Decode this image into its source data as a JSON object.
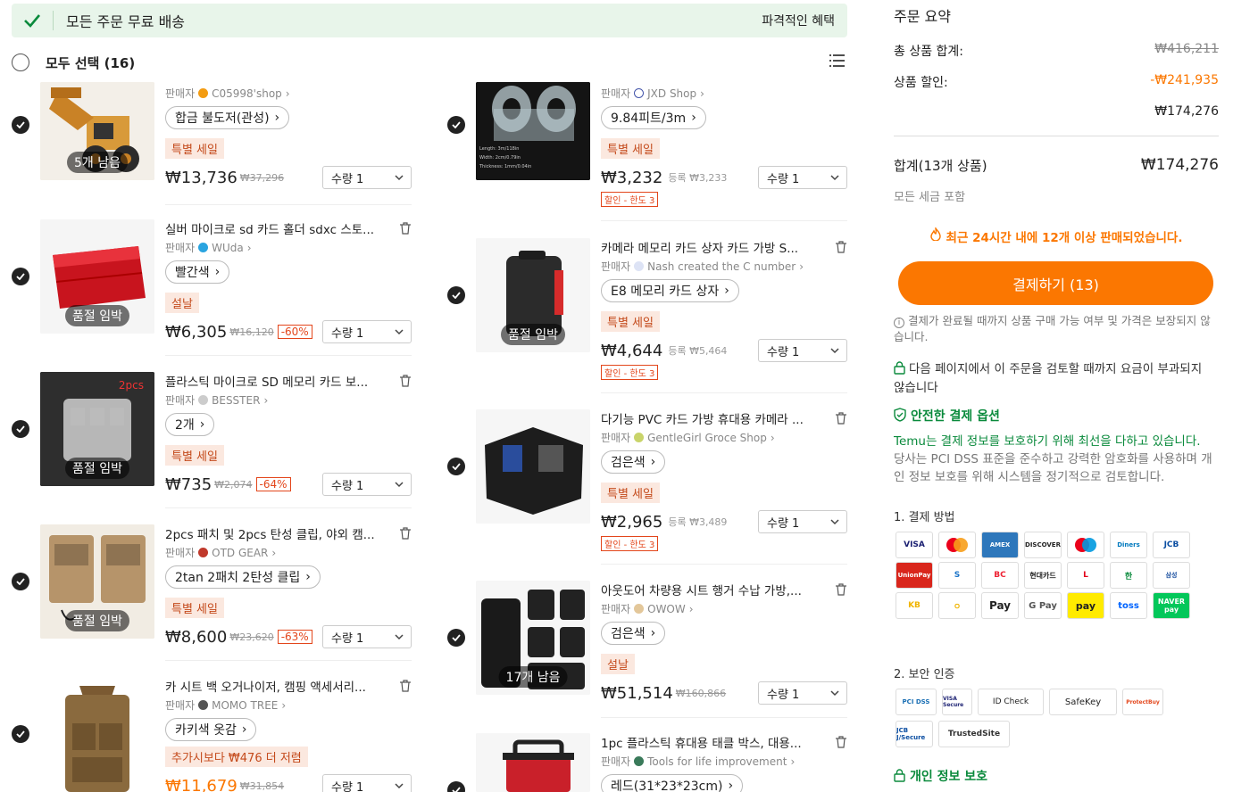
{
  "banner": {
    "title": "모든 주문 무료 배송",
    "right": "파격적인 혜택"
  },
  "select_all": {
    "label": "모두 선택 (16)"
  },
  "items_left": [
    {
      "seller": "C05998'shop",
      "variant": "합금 불도저(관성)",
      "tag": "특별 세일",
      "price": "₩13,736",
      "orig": "₩37,296",
      "qty": "수량 1",
      "badge": "5개 남음"
    },
    {
      "title": "실버 마이크로 sd 카드 홀더 sdxc 스토...",
      "seller": "WUda",
      "variant": "빨간색",
      "tag": "설날",
      "price": "₩6,305",
      "orig": "₩16,120",
      "disc": "-60%",
      "qty": "수량 1",
      "badge": "품절 임박"
    },
    {
      "title": "플라스틱 마이크로 SD 메모리 카드 보...",
      "seller": "BESSTER",
      "variant": "2개",
      "tag": "특별 세일",
      "price": "₩735",
      "orig": "₩2,074",
      "disc": "-64%",
      "qty": "수량 1",
      "badge": "품절 임박",
      "thumb_label": "2pcs"
    },
    {
      "title": "2pcs 패치 및 2pcs 탄성 클립, 야외 캠...",
      "seller": "OTD GEAR",
      "variant": "2tan 2패치 2탄성 클립",
      "tag": "특별 세일",
      "price": "₩8,600",
      "orig": "₩23,620",
      "disc": "-63%",
      "qty": "수량 1",
      "badge": "품절 임박"
    },
    {
      "title": "카 시트 백 오거나이저, 캠핑 액세서리...",
      "seller": "MOMO TREE",
      "variant": "카키색 옷감",
      "tag": "추가시보다 ₩476 더 저렴",
      "price": "₩11,679",
      "orig": "₩31,854",
      "qty": "수량 1"
    }
  ],
  "items_right": [
    {
      "seller": "JXD Shop",
      "variant": "9.84피트/3m",
      "tag": "특별 세일",
      "price": "₩3,232",
      "reg": "등록 ₩3,233",
      "limit": "할인 - 한도 3",
      "qty": "수량 1"
    },
    {
      "title": "카메라 메모리 카드 상자 카드 가방 S...",
      "seller": "Nash created the C number",
      "variant": "E8 메모리 카드 상자",
      "tag": "특별 세일",
      "price": "₩4,644",
      "reg": "등록 ₩5,464",
      "limit": "할인 - 한도 3",
      "qty": "수량 1",
      "badge": "품절 임박"
    },
    {
      "title": "다기능 PVC 카드 가방 휴대용 카메라 ...",
      "seller": "GentleGirl Groce Shop",
      "variant": "검은색",
      "tag": "특별 세일",
      "price": "₩2,965",
      "reg": "등록 ₩3,489",
      "limit": "할인 - 한도 3",
      "qty": "수량 1"
    },
    {
      "title": "아웃도어 차량용 시트 행거 수납 가방,...",
      "seller": "OWOW",
      "variant": "검은색",
      "tag": "설날",
      "price": "₩51,514",
      "orig": "₩160,866",
      "qty": "수량 1",
      "badge": "17개 남음"
    },
    {
      "title": "1pc 플라스틱 휴대용 태클 박스, 대용...",
      "seller": "Tools for life improvement",
      "variant": "레드(31*23*23cm)"
    }
  ],
  "labels": {
    "seller_prefix": "판매자"
  },
  "summary": {
    "title": "주문 요약",
    "total_label": "총 상품 합계:",
    "total_value": "₩416,211",
    "discount_label": "상품 할인:",
    "discount_value": "-₩241,935",
    "subtotal": "₩174,276",
    "sum_label": "합계(13개 상품)",
    "sum_value": "₩174,276",
    "tax": "모든 세금 포함",
    "hot": "최근 24시간 내에 12개 이상 판매되었습니다.",
    "checkout": "결제하기 (13)",
    "note1": "결제가 완료될 때까지 상품 구매 가능 여부 및 가격은 보장되지 않습니다.",
    "note2": "다음 페이지에서 이 주문을 검토할 때까지 요금이 부과되지 않습니다",
    "secure_title": "안전한 결제 옵션",
    "secure_green": "Temu는 결제 정보를 보호하기 위해 최선을 다하고 있습니다.",
    "secure_rest": " 당사는 PCI DSS 표준을 준수하고 강력한 암호화를 사용하며 개인 정보 보호를 위해 시스템을 정기적으로 검토합니다.",
    "pay_methods_label": "1. 결제 방법",
    "security_label": "2. 보안 인증",
    "privacy": "개인 정보 보호"
  },
  "pay_methods": [
    "VISA",
    "MC",
    "AMEX",
    "DISCOVER",
    "maestro",
    "Diners",
    "JCB",
    "UnionPay",
    "S",
    "BC",
    "현대카드",
    "L",
    "한",
    "삼성",
    "KB",
    "ㅇ",
    "Pay",
    "G Pay",
    "pay",
    "toss",
    "NAVER pay"
  ],
  "security": [
    "PCI DSS",
    "VISA Secure",
    "ID Check",
    "SafeKey",
    "ProtectBuy",
    "JCB J/Secure",
    "TrustedSite"
  ],
  "colors": {
    "accent": "#fb7701",
    "green": "#0a8a3c"
  }
}
